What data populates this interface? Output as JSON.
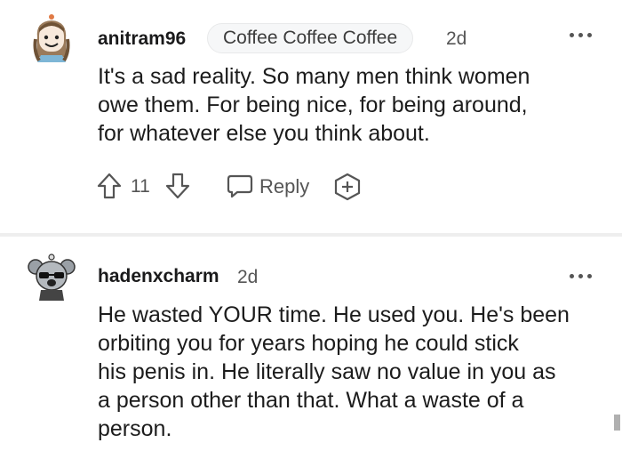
{
  "comments": [
    {
      "username": "anitram96",
      "flair": "Coffee Coffee Coffee",
      "age": "2d",
      "body": "It's a sad reality. So many men think women\nowe them. For being nice, for being around,\nfor whatever else you think about.",
      "votes": "11",
      "reply_label": "Reply"
    },
    {
      "username": "hadenxcharm",
      "age": "2d",
      "body": "He wasted YOUR time. He used you. He's been\norbiting you for years hoping he could stick\nhis penis in. He literally saw no value in you as\na person other than that. What a waste of a\nperson."
    }
  ],
  "icons": {
    "upvote": "arrow-up-icon",
    "downvote": "arrow-down-icon",
    "reply": "speech-bubble-icon",
    "award": "award-plus-icon",
    "more": "more-dots-icon"
  },
  "colors": {
    "text": "#1c1c1c",
    "meta": "#555555",
    "divider": "#eeeeee",
    "flair_bg": "#f6f7f8"
  }
}
